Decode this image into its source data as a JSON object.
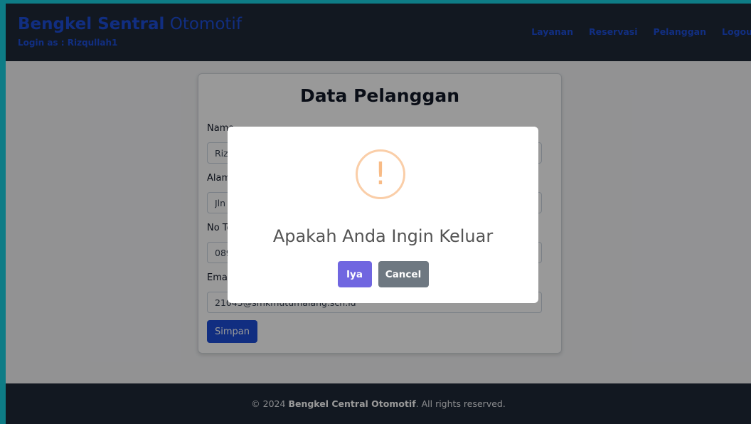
{
  "header": {
    "brand_bold": "Bengkel Sentral",
    "brand_light": "Otomotif",
    "login_as": "Login as : Rizqullah1",
    "nav": [
      "Layanan",
      "Reservasi",
      "Pelanggan",
      "Logout"
    ]
  },
  "form": {
    "title": "Data Pelanggan",
    "fields": [
      {
        "label": "Nama",
        "value": "Rizqullah1"
      },
      {
        "label": "Alamat",
        "value": "Jln Malang"
      },
      {
        "label": "No Telp",
        "value": "08912345678"
      },
      {
        "label": "Email",
        "value": "21045@smkmutumalang.sch.id"
      }
    ],
    "submit_label": "Simpan"
  },
  "footer": {
    "prefix": "© 2024",
    "brand": "Bengkel Central Otomotif",
    "suffix": ". All rights reserved."
  },
  "modal": {
    "icon": "!",
    "title": "Apakah Anda Ingin Keluar",
    "confirm_label": "Iya",
    "cancel_label": "Cancel"
  },
  "colors": {
    "brand": "#1d4ed8",
    "navbar": "#1f2937",
    "confirm": "#7066e0",
    "cancel": "#6e7881",
    "warning": "#f8bb86"
  }
}
